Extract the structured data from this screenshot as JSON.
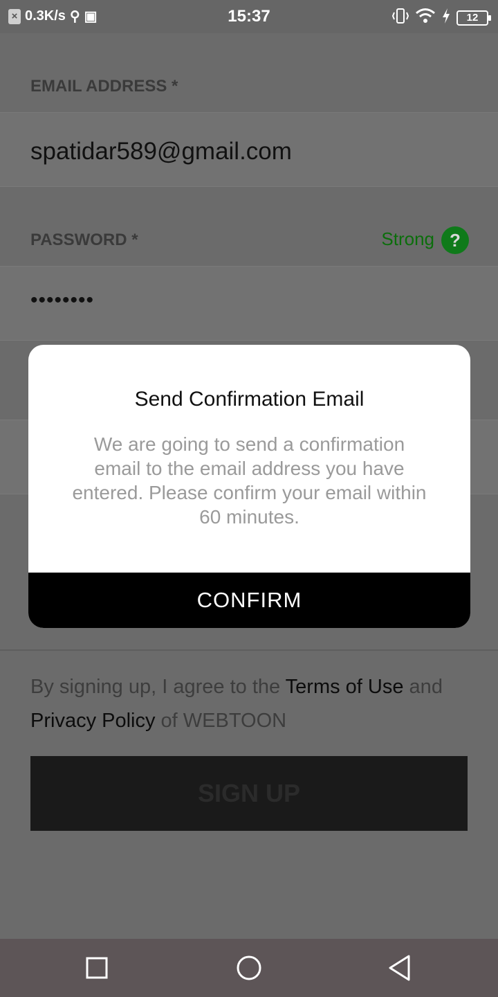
{
  "status_bar": {
    "speed": "0.3K/s",
    "time": "15:37",
    "battery": "12",
    "icons": [
      "close-x-icon",
      "usb-icon",
      "debug-icon",
      "vibrate-icon",
      "wifi-icon",
      "charging-icon",
      "battery-icon"
    ]
  },
  "form": {
    "email_label": "EMAIL ADDRESS *",
    "email_value": "spatidar589@gmail.com",
    "password_label": "PASSWORD *",
    "password_value": "••••••••",
    "strength": "Strong",
    "strength_color": "#0b6e0b",
    "help_icon": "?"
  },
  "terms": {
    "prefix": "By signing up, I agree to the ",
    "terms_link": "Terms of Use",
    "middle": " and ",
    "privacy_link": "Privacy Policy",
    "suffix": " of WEBTOON"
  },
  "signup_button": "SIGN UP",
  "dialog": {
    "title": "Send Confirmation Email",
    "message": "We are going to send a confirmation email to the email address you have entered. Please confirm your email within 60 minutes.",
    "confirm": "CONFIRM"
  },
  "nav_bar": {
    "icons": [
      "recent-apps-icon",
      "home-icon",
      "back-icon"
    ]
  }
}
